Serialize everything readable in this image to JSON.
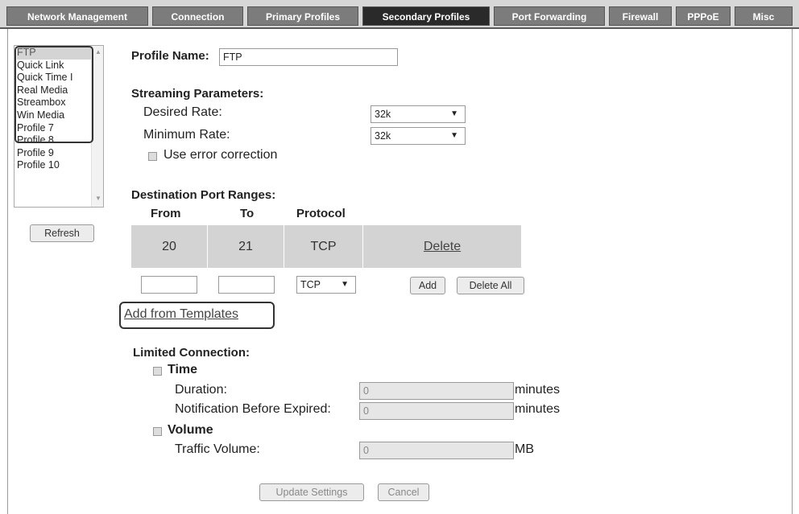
{
  "tabs": [
    {
      "label": "Network Management",
      "active": false
    },
    {
      "label": "Connection",
      "active": false
    },
    {
      "label": "Primary Profiles",
      "active": false
    },
    {
      "label": "Secondary Profiles",
      "active": true
    },
    {
      "label": "Port Forwarding",
      "active": false
    },
    {
      "label": "Firewall",
      "active": false
    },
    {
      "label": "PPPoE",
      "active": false
    },
    {
      "label": "Misc",
      "active": false
    }
  ],
  "profiles": {
    "items": [
      "FTP",
      "Quick Link",
      "Quick Time I",
      "Real Media",
      "Streambox",
      "Win Media",
      "Profile 7",
      "Profile 8",
      "Profile 9",
      "Profile 10"
    ],
    "selected": "FTP",
    "refresh_label": "Refresh"
  },
  "profile_name": {
    "label": "Profile Name:",
    "value": "FTP"
  },
  "streaming": {
    "heading": "Streaming Parameters:",
    "desired_label": "Desired Rate:",
    "desired_value": "32k",
    "minimum_label": "Minimum Rate:",
    "minimum_value": "32k",
    "error_correction_label": "Use error correction"
  },
  "ports": {
    "heading": "Destination Port Ranges:",
    "col_from": "From",
    "col_to": "To",
    "col_protocol": "Protocol",
    "rows": [
      {
        "from": "20",
        "to": "21",
        "protocol": "TCP",
        "action": "Delete"
      }
    ],
    "new_protocol": "TCP",
    "add_label": "Add",
    "delete_all_label": "Delete All",
    "templates_link": "Add from Templates"
  },
  "limited": {
    "heading": "Limited Connection:",
    "time_label": "Time",
    "duration_label": "Duration:",
    "duration_value": "0",
    "duration_unit": "minutes",
    "notification_label": "Notification Before Expired:",
    "notification_value": "0",
    "notification_unit": "minutes",
    "volume_label": "Volume",
    "traffic_label": "Traffic Volume:",
    "traffic_value": "0",
    "traffic_unit": "MB"
  },
  "footer": {
    "update_label": "Update Settings",
    "cancel_label": "Cancel"
  }
}
